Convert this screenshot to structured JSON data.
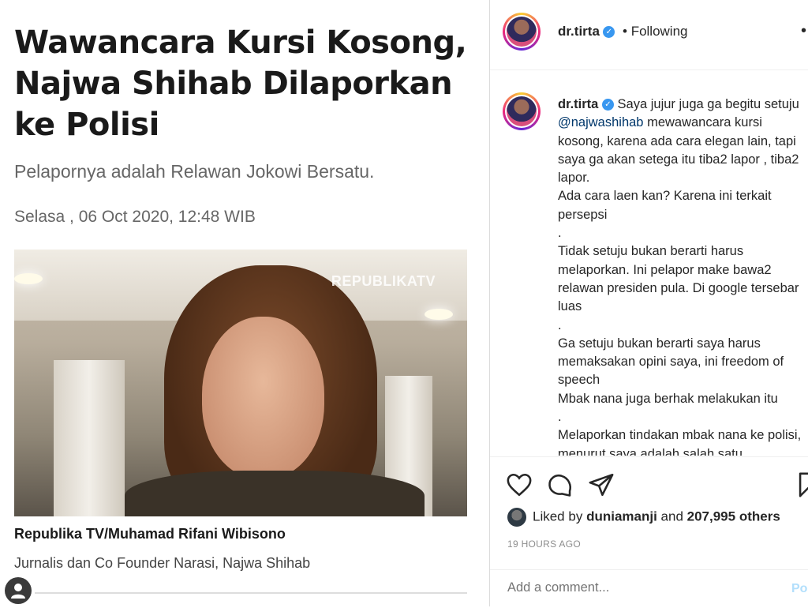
{
  "article": {
    "headline": "Wawancara Kursi Kosong, Najwa Shihab Dilaporkan ke Polisi",
    "subhead": "Pelapornya adalah Relawan Jokowi Bersatu.",
    "dateline": "Selasa , 06 Oct 2020, 12:48 WIB",
    "photo_watermark": "REPUBLIKATV",
    "credit": "Republika TV/Muhamad Rifani Wibisono",
    "caption": "Jurnalis dan Co Founder Narasi, Najwa Shihab"
  },
  "instagram": {
    "header": {
      "username": "dr.tirta",
      "separator": "•",
      "follow_status": "Following",
      "more": "•"
    },
    "comment": {
      "username": "dr.tirta",
      "text_before_mention": "Saya jujur juga ga begitu setuju",
      "mention": "@najwashihab",
      "text_after_mention": "mewawancara kursi kosong, karena ada cara elegan lain, tapi saya ga akan setega itu tiba2 lapor , tiba2 lapor.",
      "lines": [
        "Ada cara laen kan? Karena ini terkait persepsi",
        ".",
        "Tidak setuju bukan berarti harus melaporkan. Ini pelapor make bawa2 relawan presiden pula. Di google tersebar luas",
        ".",
        "Ga setuju bukan berarti saya harus memaksakan opini saya, ini freedom of speech",
        "Mbak nana juga berhak melakukan itu",
        ".",
        "Melaporkan tindakan mbak nana ke polisi, menurut saya adalah salah satu"
      ]
    },
    "likes": {
      "prefix": "Liked by",
      "user": "duniamanji",
      "and": "and",
      "count": "207,995 others"
    },
    "time_ago": "19 HOURS AGO",
    "add_comment_placeholder": "Add a comment...",
    "post_label": "Po",
    "icons": [
      "heart-icon",
      "comment-icon",
      "share-icon",
      "bookmark-icon"
    ],
    "colors": {
      "verified": "#3897f0",
      "mention": "#00376b",
      "post_disabled": "#b2dffc"
    }
  }
}
